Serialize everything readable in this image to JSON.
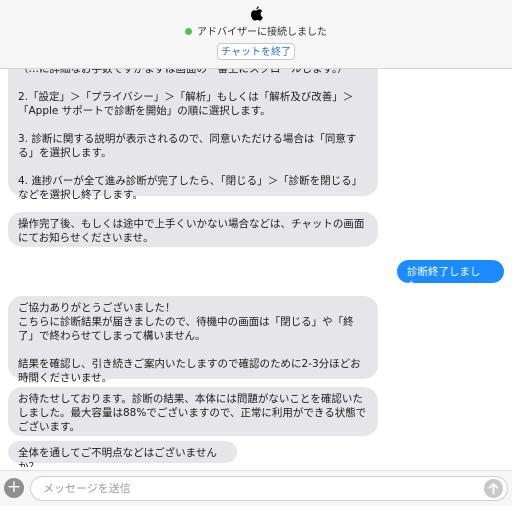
{
  "header": {
    "status_text": "アドバイザーに接続しました",
    "end_chat_label": "チャットを終了",
    "status_color": "#4cc24a"
  },
  "messages": [
    {
      "from": "advisor",
      "text": "（…に詳細なお手数ですがまずは画面の一番上にスクロールします。）\n\n2.「設定」＞「プライバシー」＞「解析」もしくは「解析及び改善」＞「Apple サポートで診断を開始」の順に選択します。\n\n3. 診断に関する説明が表示されるので、同意いただける場合は「同意する」を選択します。\n\n4. 進捗バーが全て進み診断が完了したら、「閉じる」＞「診断を閉じる」などを選択し終了します。"
    },
    {
      "from": "advisor",
      "text": "操作完了後、もしくは途中で上手くいかない場合などは、チャットの画面にてお知らせくださいませ。"
    },
    {
      "from": "user",
      "text": "診断終了しました。"
    },
    {
      "from": "advisor",
      "text": "ご協力ありがとうございました！\nこちらに診断結果が届きましたので、待機中の画面は「閉じる」や「終了」で終わらせてしまって構いません。\n\n結果を確認し、引き続きご案内いたしますので確認のために2-3分ほどお時間くださいませ。"
    },
    {
      "from": "advisor",
      "text": "お待たせしております。診断の結果、本体には問題がないことを確認いたしました。最大容量は88%でございますので、正常に利用ができる状態でございます。"
    },
    {
      "from": "advisor",
      "text": "全体を通してご不明点などはございませんか？"
    }
  ],
  "composer": {
    "placeholder": "メッセージを送信"
  },
  "colors": {
    "incoming_bubble": "#e5e5ea",
    "outgoing_bubble": "#1a8cff"
  },
  "icons": {
    "logo": "apple-logo-icon",
    "add": "plus-icon",
    "send": "send-arrow-icon"
  }
}
